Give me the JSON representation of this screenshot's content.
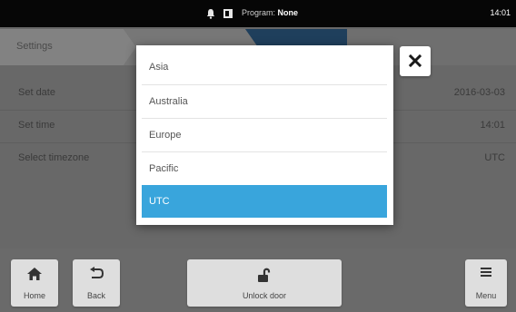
{
  "status": {
    "program_label": "Program:",
    "program_value": "None",
    "time": "14:01"
  },
  "breadcrumb": {
    "items": [
      "Settings",
      "",
      ""
    ]
  },
  "settings": [
    {
      "label": "Set date",
      "value": "2016-03-03"
    },
    {
      "label": "Set time",
      "value": "14:01"
    },
    {
      "label": "Select timezone",
      "value": "UTC"
    }
  ],
  "dialog": {
    "options": [
      "Asia",
      "Australia",
      "Europe",
      "Pacific",
      "UTC"
    ],
    "selected": "UTC"
  },
  "bottom": {
    "home": "Home",
    "back": "Back",
    "unlock": "Unlock door",
    "menu": "Menu"
  },
  "colors": {
    "accent": "#39a5dc",
    "breadcrumb_active": "#1f3f5c"
  }
}
